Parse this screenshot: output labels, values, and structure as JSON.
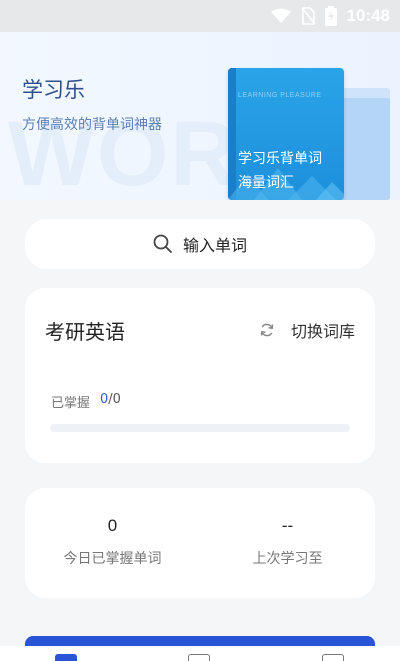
{
  "status_bar": {
    "time": "10:48",
    "icons": [
      "wifi-icon",
      "no-sim-icon",
      "battery-charging-icon"
    ]
  },
  "hero": {
    "title": "学习乐",
    "subtitle": "方便高效的背单词神器",
    "watermark": "WORD",
    "book": {
      "caption": "LEARNING PLEASURE",
      "line1": "学习乐背单词",
      "line2": "海量词汇"
    }
  },
  "search": {
    "icon": "search-icon",
    "label": "输入单词"
  },
  "library_card": {
    "name": "考研英语",
    "switch_icon": "refresh-icon",
    "switch_label": "切换词库",
    "mastered_label": "已掌握",
    "mastered_done": "0",
    "mastered_total": "/0",
    "progress_fraction": 0
  },
  "stats": {
    "today_value": "0",
    "today_label": "今日已掌握单词",
    "last_value": "--",
    "last_label": "上次学习至"
  },
  "colors": {
    "accent": "#2a54d6",
    "hero_title": "#2d4f8a",
    "book_blue": "#1d8fdc"
  }
}
